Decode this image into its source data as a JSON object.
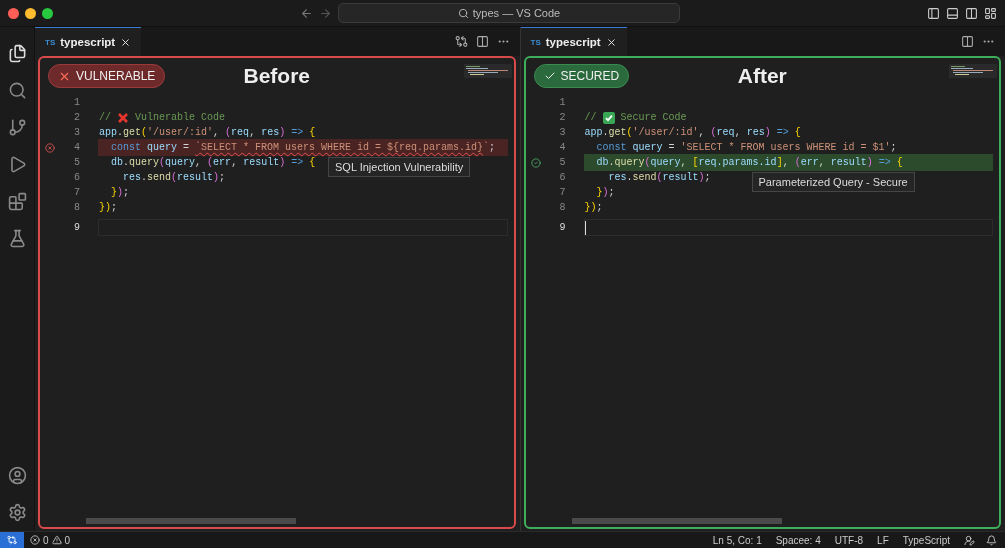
{
  "window": {
    "title": "types — VS Code"
  },
  "panes": [
    {
      "tab": {
        "icon_text": "TS",
        "label": "typescript",
        "selected": true
      },
      "secure": false,
      "badge": "VULNERABLE",
      "heading": "Before",
      "tab_actions": [
        {
          "kind": "compare"
        },
        {
          "kind": "split"
        },
        {
          "kind": "more"
        }
      ],
      "lines": [
        {
          "number": "1"
        },
        {
          "number": "2",
          "tokens": [
            {
              "kind": "comment",
              "text": "//"
            },
            {
              "kind": "cross-mark"
            },
            {
              "kind": "comment",
              "text": "Vulnerable Code"
            }
          ]
        },
        {
          "number": "3",
          "tokens": [
            {
              "kind": "var",
              "text": "app"
            },
            {
              "kind": "plain",
              "text": "."
            },
            {
              "kind": "fn",
              "text": "get"
            },
            {
              "kind": "bracket",
              "text": "("
            },
            {
              "kind": "string",
              "text": "'/user/:id'"
            },
            {
              "kind": "plain",
              "text": ", "
            },
            {
              "kind": "paren",
              "text": "("
            },
            {
              "kind": "var",
              "text": "req"
            },
            {
              "kind": "plain",
              "text": ", "
            },
            {
              "kind": "var",
              "text": "res"
            },
            {
              "kind": "paren",
              "text": ")"
            },
            {
              "kind": "keyword",
              "text": " => "
            },
            {
              "kind": "bracket",
              "text": "{"
            }
          ]
        },
        {
          "number": "4",
          "marked": true,
          "tooltip": "SQL Injection Vulnerability",
          "tokens": [
            {
              "kind": "keyword",
              "text": "  const "
            },
            {
              "kind": "var",
              "text": "query"
            },
            {
              "kind": "plain",
              "text": " = "
            },
            {
              "kind": "error-string",
              "text": "`SELECT * FROM users WHERE id = ${req.params.id}"
            },
            {
              "kind": "string",
              "text": "`"
            },
            {
              "kind": "plain",
              "text": ";"
            }
          ]
        },
        {
          "number": "5",
          "tokens": [
            {
              "kind": "var",
              "text": "  db"
            },
            {
              "kind": "plain",
              "text": "."
            },
            {
              "kind": "fn",
              "text": "query"
            },
            {
              "kind": "paren",
              "text": "("
            },
            {
              "kind": "var",
              "text": "query"
            },
            {
              "kind": "plain",
              "text": ", "
            },
            {
              "kind": "paren",
              "text": "("
            },
            {
              "kind": "var",
              "text": "err"
            },
            {
              "kind": "plain",
              "text": ", "
            },
            {
              "kind": "var",
              "text": "result"
            },
            {
              "kind": "paren",
              "text": ")"
            },
            {
              "kind": "keyword",
              "text": " => "
            },
            {
              "kind": "bracket",
              "text": "{"
            }
          ]
        },
        {
          "number": "6",
          "tokens": [
            {
              "kind": "var",
              "text": "    res"
            },
            {
              "kind": "plain",
              "text": "."
            },
            {
              "kind": "fn",
              "text": "send"
            },
            {
              "kind": "paren",
              "text": "("
            },
            {
              "kind": "var",
              "text": "result"
            },
            {
              "kind": "paren",
              "text": ")"
            },
            {
              "kind": "plain",
              "text": ";"
            }
          ]
        },
        {
          "number": "7",
          "tokens": [
            {
              "kind": "bracket",
              "text": "  }"
            },
            {
              "kind": "paren",
              "text": ")"
            },
            {
              "kind": "plain",
              "text": ";"
            }
          ]
        },
        {
          "number": "8",
          "tokens": [
            {
              "kind": "bracket",
              "text": "}"
            },
            {
              "kind": "bracket",
              "text": ")"
            },
            {
              "kind": "plain",
              "text": ";"
            }
          ]
        },
        {
          "number": "9",
          "current": true,
          "cursor": false
        }
      ]
    },
    {
      "tab": {
        "icon_text": "TS",
        "label": "typescript",
        "selected": true
      },
      "secure": true,
      "badge": "SECURED",
      "heading": "After",
      "tab_actions": [
        {
          "kind": "split"
        },
        {
          "kind": "more"
        }
      ],
      "lines": [
        {
          "number": "1"
        },
        {
          "number": "2",
          "tokens": [
            {
              "kind": "comment",
              "text": "//"
            },
            {
              "kind": "check-mark"
            },
            {
              "kind": "comment",
              "text": "Secure Code"
            }
          ]
        },
        {
          "number": "3",
          "tokens": [
            {
              "kind": "var",
              "text": "app"
            },
            {
              "kind": "plain",
              "text": "."
            },
            {
              "kind": "fn",
              "text": "get"
            },
            {
              "kind": "bracket",
              "text": "("
            },
            {
              "kind": "string",
              "text": "'/user/:id'"
            },
            {
              "kind": "plain",
              "text": ", "
            },
            {
              "kind": "paren",
              "text": "("
            },
            {
              "kind": "var",
              "text": "req"
            },
            {
              "kind": "plain",
              "text": ", "
            },
            {
              "kind": "var",
              "text": "res"
            },
            {
              "kind": "paren",
              "text": ")"
            },
            {
              "kind": "keyword",
              "text": " => "
            },
            {
              "kind": "bracket",
              "text": "{"
            }
          ]
        },
        {
          "number": "4",
          "tokens": [
            {
              "kind": "keyword",
              "text": "  const "
            },
            {
              "kind": "var",
              "text": "query"
            },
            {
              "kind": "plain",
              "text": " = "
            },
            {
              "kind": "string",
              "text": "'SELECT * FROM users WHERE id = $1'"
            },
            {
              "kind": "plain",
              "text": ";"
            }
          ]
        },
        {
          "number": "5",
          "marked": true,
          "tooltip": "Parameterized Query - Secure",
          "tokens": [
            {
              "kind": "var",
              "text": "  db"
            },
            {
              "kind": "plain",
              "text": "."
            },
            {
              "kind": "fn",
              "text": "query"
            },
            {
              "kind": "paren",
              "text": "("
            },
            {
              "kind": "var",
              "text": "query"
            },
            {
              "kind": "plain",
              "text": ", "
            },
            {
              "kind": "bracket",
              "text": "["
            },
            {
              "kind": "var",
              "text": "req.params.id"
            },
            {
              "kind": "bracket",
              "text": "]"
            },
            {
              "kind": "plain",
              "text": ", "
            },
            {
              "kind": "paren",
              "text": "("
            },
            {
              "kind": "var",
              "text": "err"
            },
            {
              "kind": "plain",
              "text": ", "
            },
            {
              "kind": "var",
              "text": "result"
            },
            {
              "kind": "paren",
              "text": ")"
            },
            {
              "kind": "keyword",
              "text": " => "
            },
            {
              "kind": "bracket",
              "text": "{"
            }
          ]
        },
        {
          "number": "6",
          "tokens": [
            {
              "kind": "var",
              "text": "    res"
            },
            {
              "kind": "plain",
              "text": "."
            },
            {
              "kind": "fn",
              "text": "send"
            },
            {
              "kind": "paren",
              "text": "("
            },
            {
              "kind": "var",
              "text": "result"
            },
            {
              "kind": "paren",
              "text": ")"
            },
            {
              "kind": "plain",
              "text": ";"
            }
          ]
        },
        {
          "number": "7",
          "tokens": [
            {
              "kind": "bracket",
              "text": "  }"
            },
            {
              "kind": "paren",
              "text": ")"
            },
            {
              "kind": "plain",
              "text": ";"
            }
          ]
        },
        {
          "number": "8",
          "tokens": [
            {
              "kind": "bracket",
              "text": "}"
            },
            {
              "kind": "bracket",
              "text": ")"
            },
            {
              "kind": "plain",
              "text": ";"
            }
          ]
        },
        {
          "number": "9",
          "current": true,
          "cursor": true
        }
      ]
    }
  ],
  "status_bar": {
    "errors": "0",
    "warnings": "0",
    "items": [
      "Ln 5, Co: 1",
      "Spacee: 4",
      "UTF-8",
      "LF",
      "TypeScript"
    ]
  }
}
